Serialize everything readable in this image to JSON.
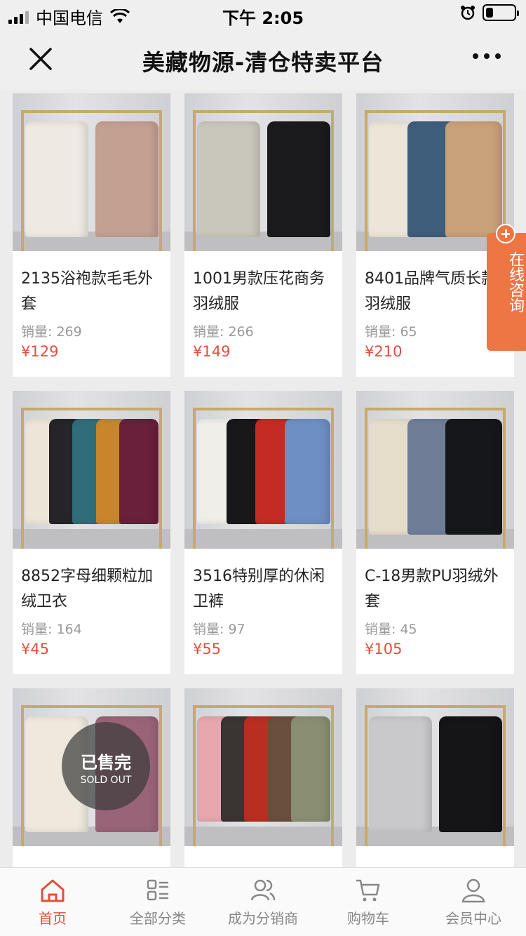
{
  "status_bar": {
    "carrier": "中国电信",
    "time": "下午 2:05",
    "battery_level": 0.25
  },
  "nav": {
    "title": "美藏物源-清仓特卖平台"
  },
  "sales_label": "销量",
  "products": [
    {
      "title": "2135浴袍款毛毛外套",
      "sales": "销量: 269",
      "price": "¥129",
      "colors": [
        "#eeeae2",
        "#c4a092"
      ]
    },
    {
      "title": "1001男款压花商务羽绒服",
      "sales": "销量: 266",
      "price": "¥149",
      "colors": [
        "#c9c7bb",
        "#1b1b1e"
      ]
    },
    {
      "title": "8401品牌气质长款羽绒服",
      "sales": "销量: 65",
      "price": "¥210",
      "colors": [
        "#ece5d8",
        "#3f5e7b",
        "#c9a17a"
      ]
    },
    {
      "title": "8852字母细颗粒加绒卫衣",
      "sales": "销量: 164",
      "price": "¥45",
      "colors": [
        "#ede6d8",
        "#262428",
        "#2f6d78",
        "#c8862c",
        "#6a1f3b"
      ]
    },
    {
      "title": "3516特别厚的休闲卫裤",
      "sales": "销量: 97",
      "price": "¥55",
      "colors": [
        "#f0eee9",
        "#18181a",
        "#c42b24",
        "#6e8fc4"
      ]
    },
    {
      "title": "C-18男款PU羽绒外套",
      "sales": "销量: 45",
      "price": "¥105",
      "colors": [
        "#e7ddcb",
        "#6f7d97",
        "#16171a"
      ]
    },
    {
      "title": "",
      "sales": "",
      "price": "",
      "colors": [
        "#efe9dd",
        "#9a6478"
      ],
      "sold_out": true
    },
    {
      "title": "",
      "sales": "",
      "price": "",
      "colors": [
        "#e6a7ad",
        "#3a3432",
        "#b82f22",
        "#6a4f3c",
        "#8a8f72"
      ]
    },
    {
      "title": "",
      "sales": "",
      "price": "",
      "colors": [
        "#c9c9cb",
        "#151518"
      ]
    }
  ],
  "sold_out_badge": {
    "cn": "已售完",
    "en": "SOLD OUT"
  },
  "consult_button": {
    "label": "在线咨询"
  },
  "tab_bar": {
    "items": [
      {
        "label": "首页",
        "icon": "home-icon",
        "active": true
      },
      {
        "label": "全部分类",
        "icon": "category-icon",
        "active": false
      },
      {
        "label": "成为分销商",
        "icon": "users-icon",
        "active": false
      },
      {
        "label": "购物车",
        "icon": "cart-icon",
        "active": false
      },
      {
        "label": "会员中心",
        "icon": "user-icon",
        "active": false
      }
    ]
  },
  "colors": {
    "accent": "#e64c3c",
    "consult": "#ee7645",
    "background": "#ececec"
  }
}
